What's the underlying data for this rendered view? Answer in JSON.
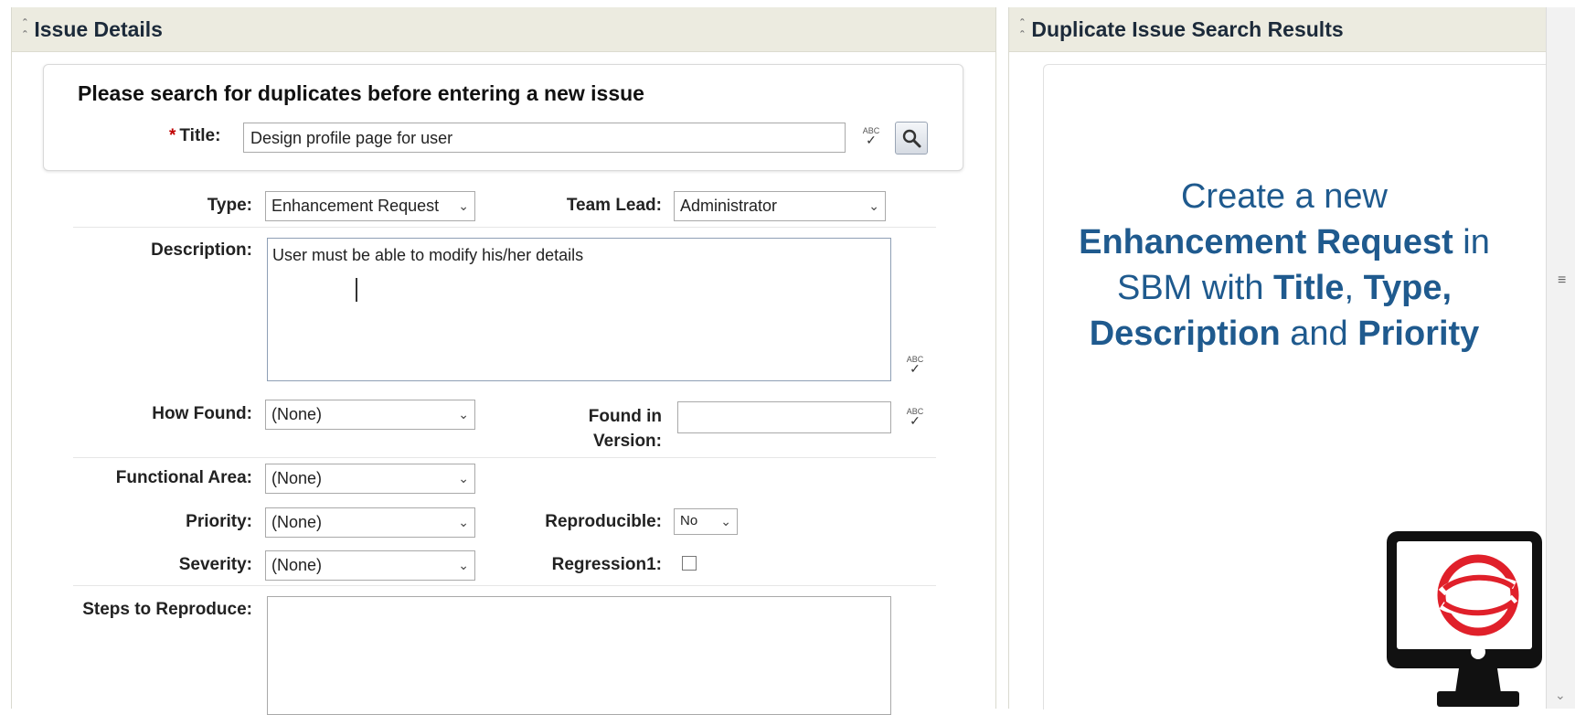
{
  "left_panel": {
    "title": "Issue Details",
    "prompt": "Please search for duplicates before entering a new issue",
    "title_field": {
      "label": "Title:",
      "required_mark": "*",
      "value": "Design profile page for user"
    },
    "type": {
      "label": "Type:",
      "value": "Enhancement Request"
    },
    "team_lead": {
      "label": "Team Lead:",
      "value": "Administrator"
    },
    "description": {
      "label": "Description:",
      "value": "User must be able to modify his/her details"
    },
    "how_found": {
      "label": "How Found:",
      "value": "(None)"
    },
    "found_in_version": {
      "label_line1": "Found in",
      "label_line2": "Version:",
      "value": ""
    },
    "functional_area": {
      "label": "Functional Area:",
      "value": "(None)"
    },
    "priority": {
      "label": "Priority:",
      "value": "(None)"
    },
    "reproducible": {
      "label": "Reproducible:",
      "value": "No"
    },
    "severity": {
      "label": "Severity:",
      "value": "(None)"
    },
    "regression": {
      "label": "Regression1:",
      "checked": false
    },
    "steps": {
      "label": "Steps to Reproduce:",
      "value": ""
    },
    "spell_icon_text": "ABC"
  },
  "right_panel": {
    "title": "Duplicate Issue Search Results",
    "message": {
      "line1": "Create a new",
      "line2_bold": "Enhancement Request",
      "line2_tail": " in",
      "line3_head": "SBM with ",
      "line3_bold1": "Title",
      "line3_sep": ", ",
      "line3_bold2": "Type,",
      "line4_bold1": "Description",
      "line4_mid": " and ",
      "line4_bold2": "Priority"
    }
  },
  "icons": {
    "collapse": "chevron-up-icon",
    "search": "magnifier-icon",
    "dropdown": "chevron-down-icon",
    "spellcheck": "spellcheck-icon",
    "logo": "monitor-logo-icon"
  },
  "colors": {
    "header_bg": "#ecebe0",
    "message_text": "#1f5a8e",
    "required": "#c00000",
    "logo_red": "#e0202a"
  }
}
